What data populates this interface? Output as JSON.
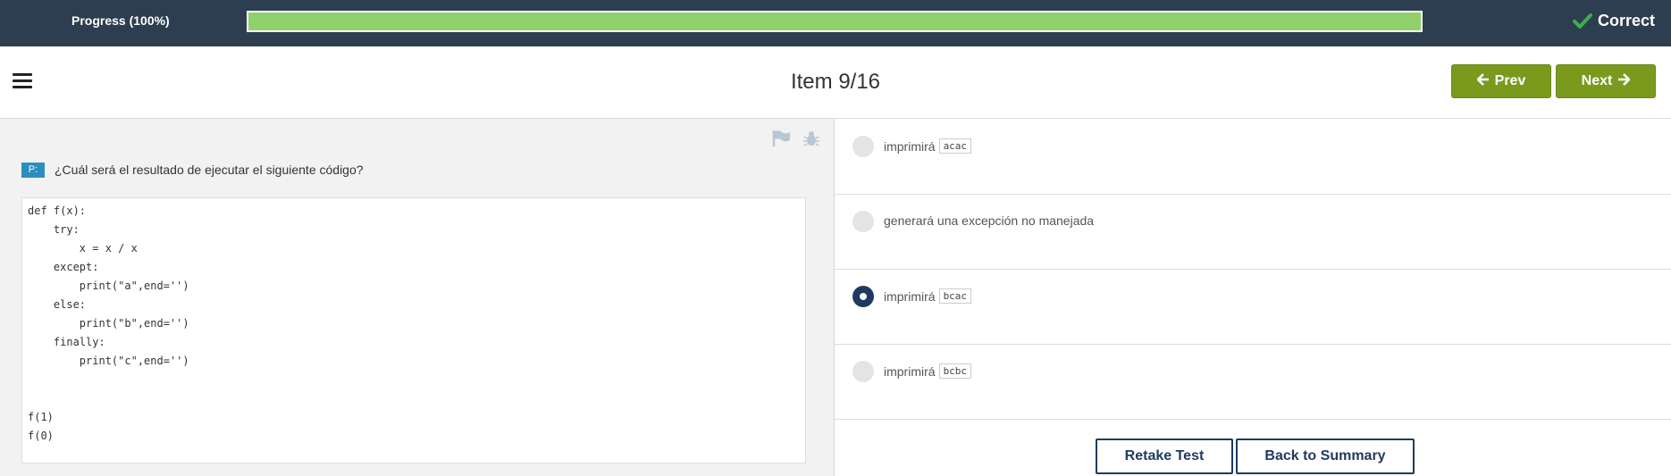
{
  "progress": {
    "label": "Progress (100%)",
    "value_percent": 100
  },
  "result": {
    "label": "Correct",
    "icon": "check-icon",
    "icon_color": "#3fae49"
  },
  "header": {
    "item_label": "Item 9/16",
    "prev_label": "Prev",
    "next_label": "Next",
    "menu_icon": "hamburger-icon",
    "button_color": "#7a9a1e"
  },
  "question": {
    "badge": "P:",
    "text": "¿Cuál será el resultado de ejecutar el siguiente código?",
    "code": "def f(x):\n    try:\n        x = x / x\n    except:\n        print(\"a\",end='')\n    else:\n        print(\"b\",end='')\n    finally:\n        print(\"c\",end='')\n\n\nf(1)\nf(0)"
  },
  "options": [
    {
      "prefix": "imprimirá",
      "code": "acac",
      "selected": false
    },
    {
      "prefix": "generará una excepción no manejada",
      "code": "",
      "selected": false
    },
    {
      "prefix": "imprimirá",
      "code": "bcac",
      "selected": true
    },
    {
      "prefix": "imprimirá",
      "code": "bcbc",
      "selected": false
    }
  ],
  "footer": {
    "retake_label": "Retake Test",
    "summary_label": "Back to Summary"
  }
}
